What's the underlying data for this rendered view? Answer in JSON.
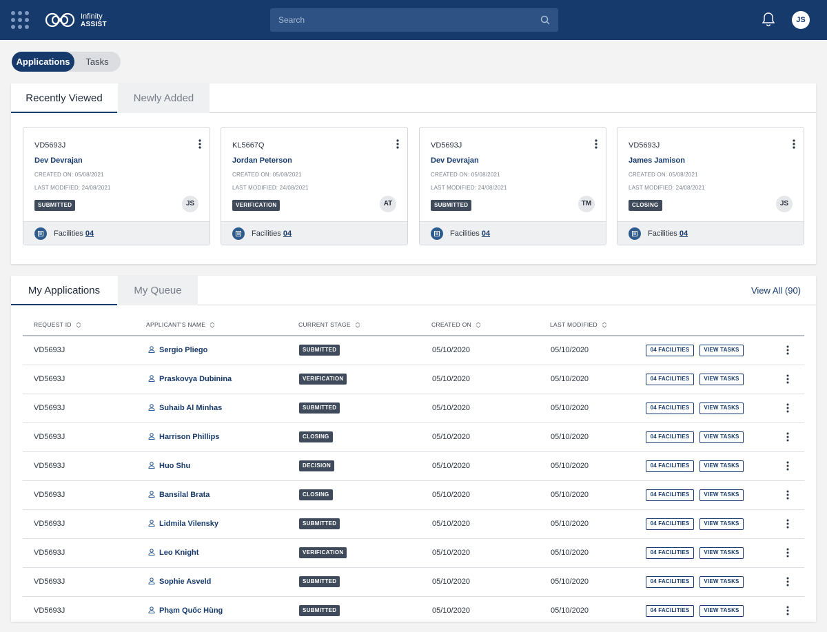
{
  "header": {
    "logo_line1": "Infinity",
    "logo_line2": "ASSIST",
    "search_placeholder": "Search",
    "user_initials": "JS"
  },
  "toggle": {
    "applications": "Applications",
    "tasks": "Tasks",
    "selected": "Applications"
  },
  "recent": {
    "tabs": [
      "Recently Viewed",
      "Newly Added"
    ],
    "cards": [
      {
        "id": "VD5693J",
        "name": "Dev Devrajan",
        "created": "CREATED ON: 05/08/2021",
        "modified": "LAST MODIFIED: 24/08/2021",
        "status": "SUBMITTED",
        "initials": "JS",
        "facilities_label": "Facilities",
        "facilities_count": "04"
      },
      {
        "id": "KL5667Q",
        "name": "Jordan Peterson",
        "created": "CREATED ON: 05/08/2021",
        "modified": "LAST MODIFIED: 24/08/2021",
        "status": "VERIFICATION",
        "initials": "AT",
        "facilities_label": "Facilities",
        "facilities_count": "04"
      },
      {
        "id": "VD5693J",
        "name": "Dev Devrajan",
        "created": "CREATED ON: 05/08/2021",
        "modified": "LAST MODIFIED: 24/08/2021",
        "status": "SUBMITTED",
        "initials": "TM",
        "facilities_label": "Facilities",
        "facilities_count": "04"
      },
      {
        "id": "VD5693J",
        "name": "James Jamison",
        "created": "CREATED ON: 05/08/2021",
        "modified": "LAST MODIFIED: 24/08/2021",
        "status": "CLOSING",
        "initials": "JS",
        "facilities_label": "Facilities",
        "facilities_count": "04"
      }
    ]
  },
  "applications": {
    "tabs": [
      "My Applications",
      "My Queue"
    ],
    "view_all": "View All (90)",
    "columns": [
      "REQUEST ID",
      "APPLICANT'S NAME",
      "CURRENT STAGE",
      "CREATED ON",
      "LAST MODIFIED"
    ],
    "facilities_btn": "04 FACILITIES",
    "tasks_btn": "VIEW TASKS",
    "rows": [
      {
        "id": "VD5693J",
        "name": "Sergio Pliego",
        "stage": "SUBMITTED",
        "created": "05/10/2020",
        "modified": "05/10/2020"
      },
      {
        "id": "VD5693J",
        "name": "Praskovya Dubinina",
        "stage": "VERIFICATION",
        "created": "05/10/2020",
        "modified": "05/10/2020"
      },
      {
        "id": "VD5693J",
        "name": "Suhaib Al Minhas",
        "stage": "SUBMITTED",
        "created": "05/10/2020",
        "modified": "05/10/2020"
      },
      {
        "id": "VD5693J",
        "name": "Harrison Phillips",
        "stage": "CLOSING",
        "created": "05/10/2020",
        "modified": "05/10/2020"
      },
      {
        "id": "VD5693J",
        "name": "Huo Shu",
        "stage": "DECISION",
        "created": "05/10/2020",
        "modified": "05/10/2020"
      },
      {
        "id": "VD5693J",
        "name": "Bansilal Brata",
        "stage": "CLOSING",
        "created": "05/10/2020",
        "modified": "05/10/2020"
      },
      {
        "id": "VD5693J",
        "name": "Lidmila Vilensky",
        "stage": "SUBMITTED",
        "created": "05/10/2020",
        "modified": "05/10/2020"
      },
      {
        "id": "VD5693J",
        "name": "Leo Knight",
        "stage": "VERIFICATION",
        "created": "05/10/2020",
        "modified": "05/10/2020"
      },
      {
        "id": "VD5693J",
        "name": "Sophie Asveld",
        "stage": "SUBMITTED",
        "created": "05/10/2020",
        "modified": "05/10/2020"
      },
      {
        "id": "VD5693J",
        "name": "Phạm Quốc Hùng",
        "stage": "SUBMITTED",
        "created": "05/10/2020",
        "modified": "05/10/2020"
      }
    ]
  },
  "colors": {
    "brand": "#163a6b",
    "badge": "#3f4a5a"
  }
}
